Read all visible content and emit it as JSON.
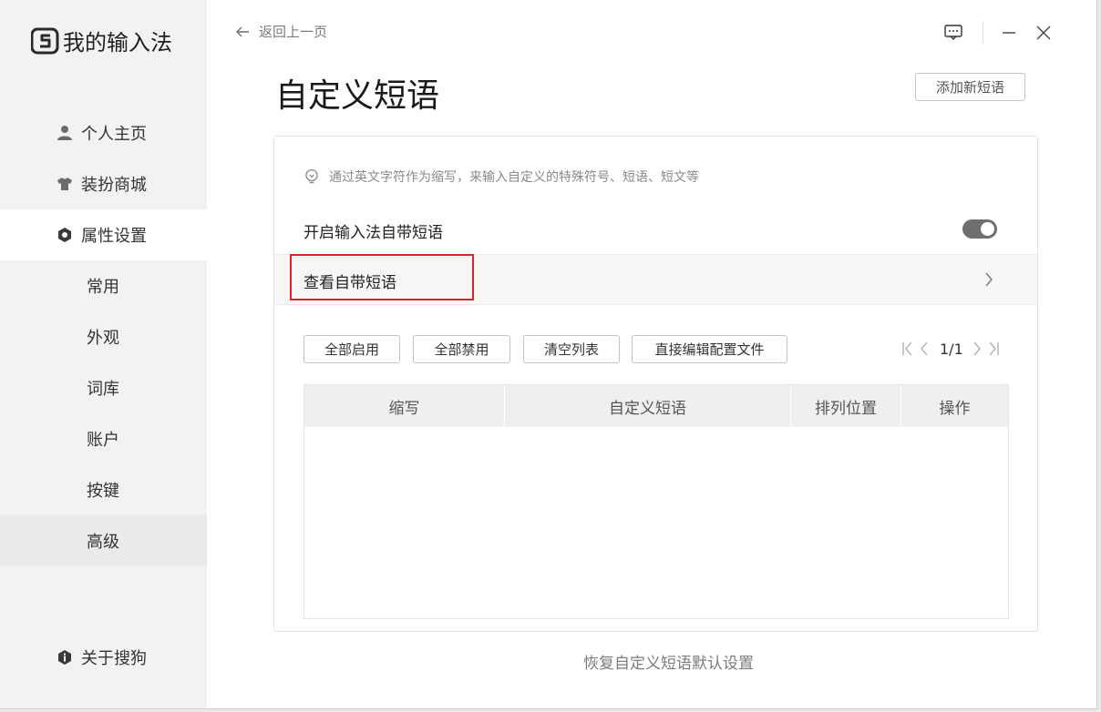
{
  "app": {
    "name": "我的输入法",
    "back_label": "返回上一页"
  },
  "sidebar": {
    "items": [
      {
        "label": "个人主页",
        "icon": "user-icon"
      },
      {
        "label": "装扮商城",
        "icon": "shirt-icon"
      },
      {
        "label": "属性设置",
        "icon": "settings-hexagon-icon",
        "active": true
      }
    ],
    "sub_items": [
      {
        "label": "常用"
      },
      {
        "label": "外观"
      },
      {
        "label": "词库"
      },
      {
        "label": "账户"
      },
      {
        "label": "按键"
      },
      {
        "label": "高级",
        "selected": true
      }
    ],
    "about_label": "关于搜狗"
  },
  "page": {
    "title": "自定义短语",
    "add_button": "添加新短语",
    "hint": "通过英文字符作为缩写，来输入自定义的特殊符号、短语、短文等",
    "toggle_label": "开启输入法自带短语",
    "toggle_on": true,
    "view_builtin_label": "查看自带短语",
    "actions": [
      "全部启用",
      "全部禁用",
      "清空列表",
      "直接编辑配置文件"
    ],
    "pager": {
      "text": "1/1"
    },
    "table": {
      "columns": [
        "缩写",
        "自定义短语",
        "排列位置",
        "操作"
      ],
      "rows": []
    },
    "restore_label": "恢复自定义短语默认设置"
  },
  "colors": {
    "sidebar_bg": "#f2f2f2",
    "highlight_border": "#d9262a",
    "toggle_bg": "#6f6f6f"
  }
}
